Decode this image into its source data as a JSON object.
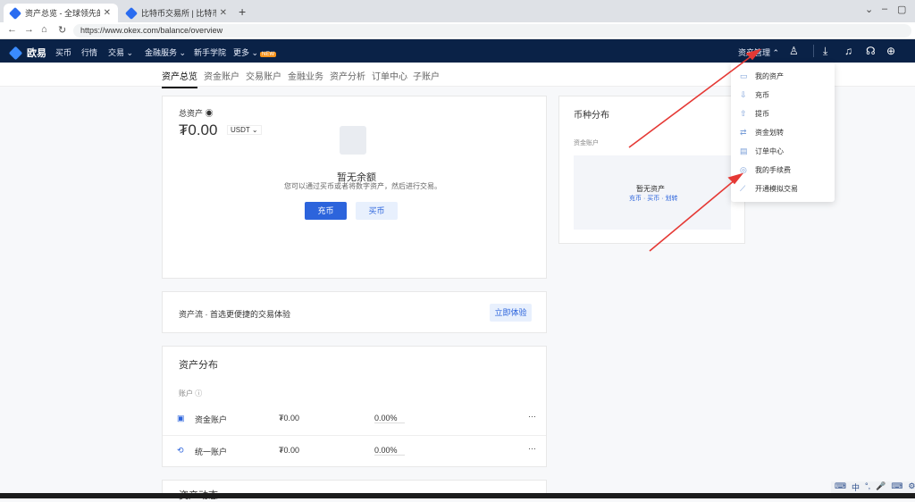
{
  "browser": {
    "tabs": [
      {
        "label": "资产总览 - 全球领先的比特币交"
      },
      {
        "label": "比特币交易所 | 比特币交易平台"
      }
    ],
    "url": "https://www.okex.com/balance/overview"
  },
  "topnav": {
    "logo": "欧易",
    "items": [
      "买币",
      "行情",
      "交易 ⌄",
      "金融服务 ⌄",
      "新手学院",
      "更多 ⌄"
    ],
    "badge": "NEW",
    "asset_management": "资产管理 ⌃"
  },
  "subnav": {
    "tabs": [
      "资产总览",
      "资金账户",
      "交易账户",
      "金融业务",
      "资产分析",
      "订单中心",
      "子账户"
    ]
  },
  "balance_card": {
    "label": "总资产 ◉",
    "amount": "₮0.00",
    "unit": "USDT ⌄",
    "empty_title": "暂无余额",
    "empty_desc": "您可以通过买币或者将数字资产，然后进行交易。",
    "deposit_btn": "充币",
    "buy_btn": "买币"
  },
  "promo": {
    "text": "资产流 · 首选更便捷的交易体验",
    "btn": "立即体验"
  },
  "distribution": {
    "title": "资产分布",
    "subtitle": "账户 ⓘ",
    "rows": [
      {
        "name": "资金账户",
        "value": "₮0.00",
        "pct": "0.00%"
      },
      {
        "name": "统一账户",
        "value": "₮0.00",
        "pct": "0.00%"
      }
    ],
    "more": "···",
    "next_section": "资产动态"
  },
  "currency_card": {
    "title": "币种分布",
    "subtitle": "资金账户",
    "empty_title": "暂无资产",
    "empty_desc": "充币 · 买币 · 划转"
  },
  "dropdown": {
    "items": [
      {
        "icon": "▭",
        "label": "我的资产"
      },
      {
        "icon": "⇩",
        "label": "充币"
      },
      {
        "icon": "⇧",
        "label": "提币"
      },
      {
        "icon": "⇄",
        "label": "资金划转"
      },
      {
        "icon": "▤",
        "label": "订单中心"
      },
      {
        "icon": "◎",
        "label": "我的手续费"
      },
      {
        "icon": "⟋",
        "label": "开通模拟交易"
      }
    ]
  },
  "tray": {
    "items": [
      "⌨",
      "中",
      "°,",
      "🎤",
      "⌨",
      "⚙"
    ]
  },
  "colors": {
    "nav_bg": "#0a2247",
    "accent": "#2c64dc",
    "arrow": "#e53935"
  }
}
